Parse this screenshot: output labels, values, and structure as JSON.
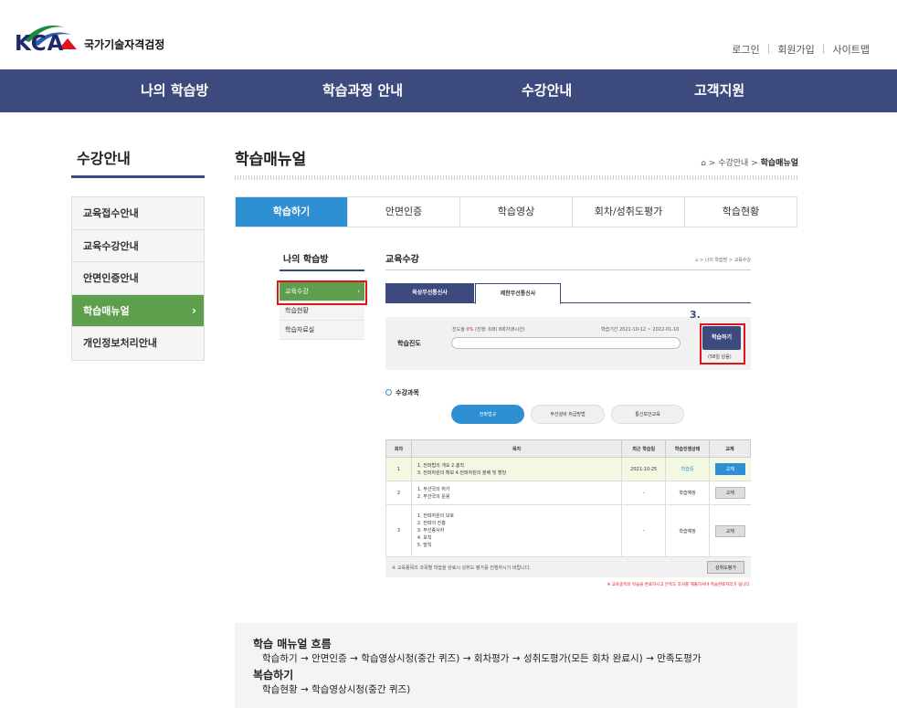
{
  "header": {
    "logo_text": "KCA",
    "logo_sub": "국가기술자격검정",
    "util": [
      "로그인",
      "회원가입",
      "사이트맵"
    ],
    "gnb": [
      "나의 학습방",
      "학습과정 안내",
      "수강안내",
      "고객지원"
    ]
  },
  "sidebar": {
    "title": "수강안내",
    "items": [
      {
        "label": "교육접수안내",
        "active": false
      },
      {
        "label": "교육수강안내",
        "active": false
      },
      {
        "label": "안면인증안내",
        "active": false
      },
      {
        "label": "학습매뉴얼",
        "active": true
      },
      {
        "label": "개인정보처리안내",
        "active": false
      }
    ],
    "arrow": "›"
  },
  "main": {
    "title": "학습매뉴얼",
    "breadcrumb": [
      "수강안내",
      "학습매뉴얼"
    ],
    "tabs": [
      "학습하기",
      "안면인증",
      "학습영상",
      "회차/성취도평가",
      "학습현황"
    ],
    "active_tab": 0
  },
  "shot": {
    "lnb_title": "나의 학습방",
    "lnb_items": [
      "교육수강",
      "학습현황",
      "학습자료실"
    ],
    "title": "교육수강",
    "breadcrumb": "⌂ > 나의 학습방 > 교육수강",
    "tabs": [
      "육상무선통신사",
      "제한무선통신사"
    ],
    "progress": {
      "label": "학습진도",
      "info_prefix": "진도율",
      "info_pct": "0%",
      "info_rest": "(진행: 0/8) 8회차(8시간)",
      "period": "학습기간 2021-10-12 ~ 2022-01-10",
      "value": 0,
      "button": "학습하기",
      "remain": "(58일 남음)",
      "step": "3."
    },
    "course_title": "수강과목",
    "pills": [
      "전파법규",
      "무선설비 취급방법",
      "통신보안교육"
    ],
    "table": {
      "headers": [
        "회차",
        "목차",
        "최근 학습일",
        "학습진행상태",
        "교재"
      ],
      "rows": [
        {
          "no": "1",
          "toc": [
            "1. 전파법의 개요 2.총칙",
            "3. 전파자원의 확보 4.전파자원의 분배 및 할당"
          ],
          "date": "2021-10-25",
          "status": "학습중",
          "book": "교재",
          "highlight": true
        },
        {
          "no": "2",
          "toc": [
            "1. 무선국의 허가",
            "2. 무선국의 운용"
          ],
          "date": "-",
          "status": "학습예정",
          "book": "교재",
          "highlight": false
        },
        {
          "no": "3",
          "toc": [
            "1. 전파자원의 보호",
            "2. 전파의 진흥",
            "3. 무선종사자",
            "4. 보칙",
            "5. 벌칙"
          ],
          "date": "-",
          "status": "학습예정",
          "book": "교재",
          "highlight": false
        }
      ]
    },
    "note": "※ 교육종목의 과목별 학습을 완료시 성취도 평가를 진행하시기 바랍니다.",
    "eval_button": "성취도평가",
    "bottom_note": "※ 교육종목의 학습을 완료하시고 만족도 조사를 제출하셔야 학습완료처리가 됩니다."
  },
  "flow": {
    "h1": "학습 매뉴얼 흐름",
    "d1": "학습하기 → 안면인증 → 학습영상시청(중간 퀴즈) → 회차평가 → 성취도평가(모든 회차 완료시) → 만족도평가",
    "h2": "복습하기",
    "d2": "학습현황 → 학습영상시청(중간 퀴즈)"
  },
  "colors": {
    "navy": "#3c4a7e",
    "green": "#5d9f4d",
    "blue": "#2e8fd3",
    "red": "#e0141e"
  }
}
